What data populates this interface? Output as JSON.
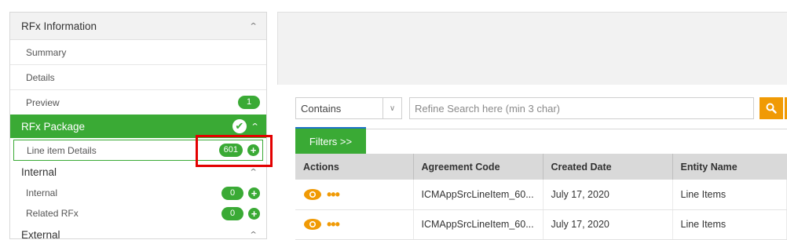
{
  "sidebar": {
    "rfx_information": {
      "title": "RFx Information",
      "items": [
        {
          "label": "Summary"
        },
        {
          "label": "Details"
        },
        {
          "label": "Preview",
          "badge": "1"
        }
      ]
    },
    "rfx_package": {
      "title": "RFx Package",
      "items": [
        {
          "label": "Line item Details",
          "badge": "601"
        }
      ]
    },
    "internal": {
      "title": "Internal",
      "items": [
        {
          "label": "Internal",
          "badge": "0"
        },
        {
          "label": "Related RFx",
          "badge": "0"
        }
      ]
    },
    "external": {
      "title": "External"
    }
  },
  "toolbar": {
    "filter_mode": "Contains",
    "search_placeholder": "Refine Search here (min 3 char)",
    "filters_label": "Filters >>"
  },
  "table": {
    "columns": [
      "Actions",
      "Agreement Code",
      "Created Date",
      "Entity Name"
    ],
    "rows": [
      {
        "agreement_code": "ICMAppSrcLineItem_60...",
        "created_date": "July 17, 2020",
        "entity_name": "Line Items"
      },
      {
        "agreement_code": "ICMAppSrcLineItem_60...",
        "created_date": "July 17, 2020",
        "entity_name": "Line Items"
      }
    ]
  },
  "colors": {
    "accent_green": "#3aaa35",
    "accent_orange": "#f09a05",
    "highlight_red": "#e30000"
  }
}
